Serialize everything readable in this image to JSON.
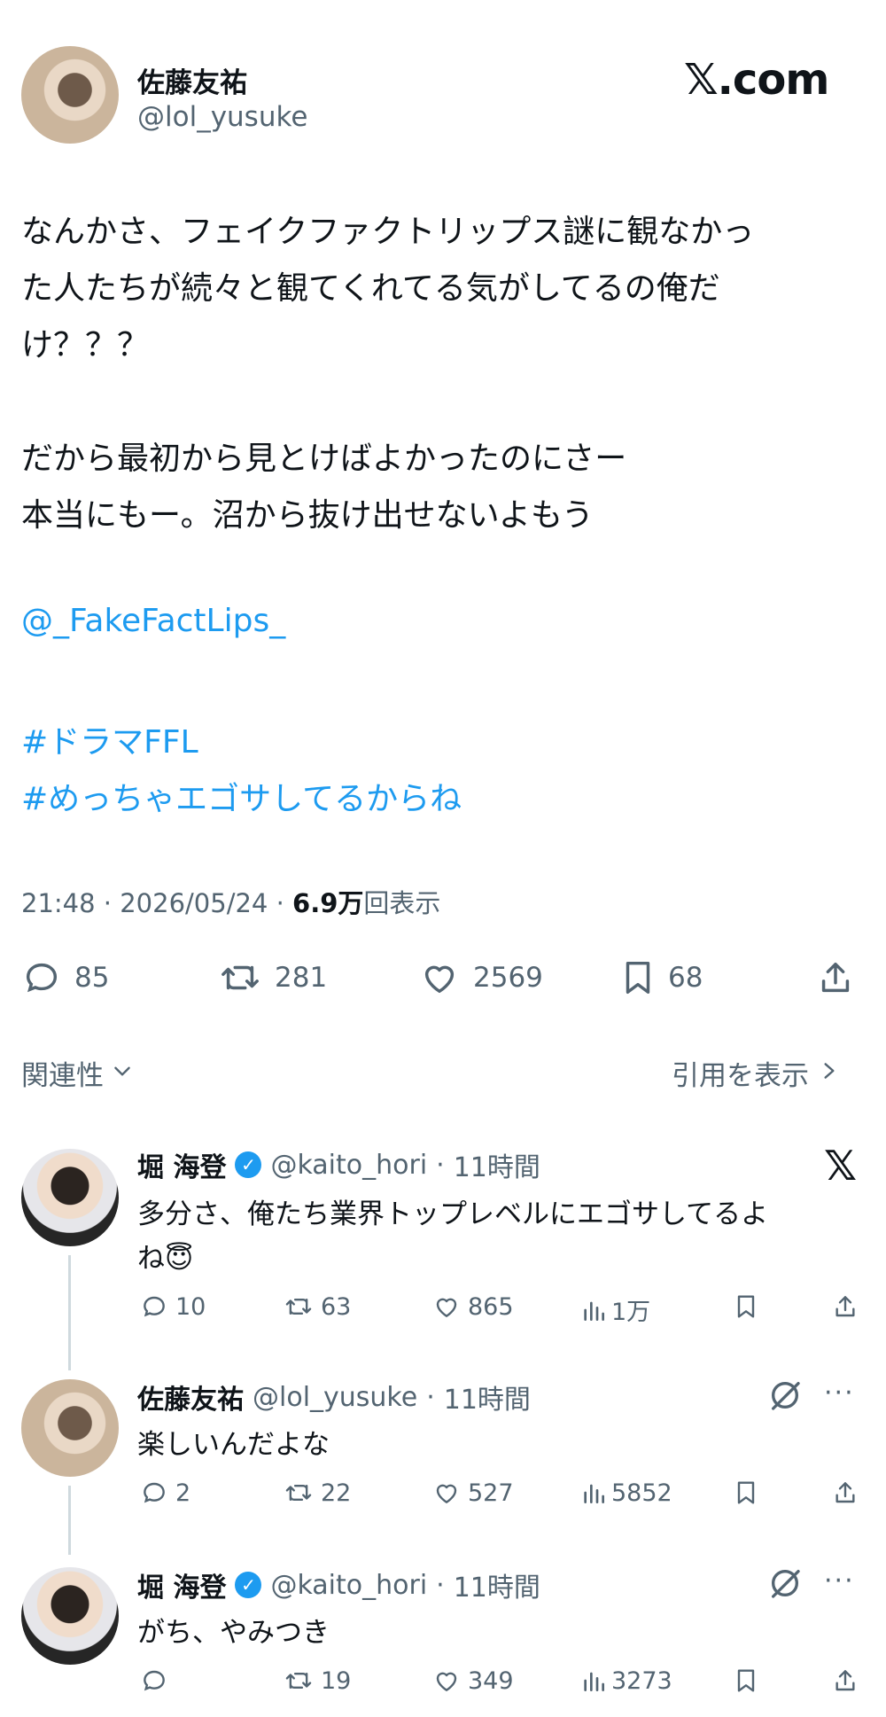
{
  "main_tweet": {
    "author_name": "佐藤友祐",
    "author_handle": "@lol_yusuke",
    "brand": "𝕏.com",
    "text_lines": [
      "なんかさ、フェイクファクトリップス謎に観なかっ",
      "た人たちが続々と観てくれてる気がしてるの俺だ",
      "け？？？",
      "だから最初から見とけばよかったのにさー",
      "本当にもー。沼から抜け出せないよもう"
    ],
    "mention": "@_FakeFactLips_",
    "hashtags": [
      "#ドラマFFL",
      "#めっちゃエゴサしてるからね"
    ],
    "time": "21:48",
    "date": "2026/05/24",
    "views_count": "6.9万",
    "views_label": "回表示",
    "replies": "85",
    "retweets": "281",
    "likes": "2569",
    "bookmarks": "68"
  },
  "filters": {
    "related": "関連性",
    "quotes": "引用を表示"
  },
  "replies": [
    {
      "name": "堀 海登",
      "handle": "@kaito_hori",
      "time": "11時間",
      "text_lines": [
        "多分さ、俺たち業界トップレベルにエゴサしてるよ",
        "ね😇"
      ],
      "replies": "10",
      "retweets": "63",
      "likes": "865",
      "views": "1万"
    },
    {
      "name": "佐藤友祐",
      "handle": "@lol_yusuke",
      "time": "11時間",
      "text_lines": [
        "楽しいんだよな"
      ],
      "replies": "2",
      "retweets": "22",
      "likes": "527",
      "views": "5852"
    },
    {
      "name": "堀 海登",
      "handle": "@kaito_hori",
      "time": "11時間",
      "text_lines": [
        "がち、やみつき"
      ],
      "replies": "",
      "retweets": "19",
      "likes": "349",
      "views": "3273"
    }
  ],
  "sep": "·",
  "more": "···",
  "chev_down": "⌄",
  "chev_right": "›",
  "colors": {
    "link": "#1d9bf0",
    "muted": "#536471",
    "text": "#0f1419"
  }
}
